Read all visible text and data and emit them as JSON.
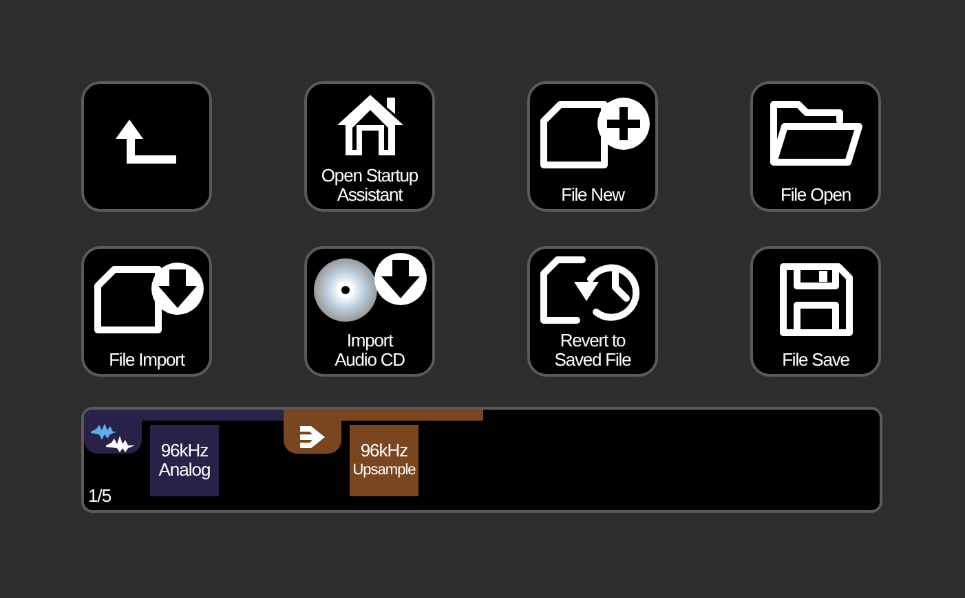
{
  "buttons": [
    {
      "kind": "back"
    },
    {
      "kind": "startup",
      "label": "Open Startup\nAssistant"
    },
    {
      "kind": "new",
      "label": "File New"
    },
    {
      "kind": "open",
      "label": "File Open"
    },
    {
      "kind": "import",
      "label": "File Import"
    },
    {
      "kind": "cd",
      "label": "Import\nAudio CD"
    },
    {
      "kind": "revert",
      "label": "Revert to\nSaved File"
    },
    {
      "kind": "save",
      "label": "File Save"
    }
  ],
  "sources": [
    {
      "line_1": "96kHz",
      "line_2": "Analog",
      "color": "#2a2148"
    },
    {
      "line_1": "96kHz",
      "line_2": "Upsample",
      "color": "#7a4620"
    }
  ],
  "page_indicator": "1/5"
}
